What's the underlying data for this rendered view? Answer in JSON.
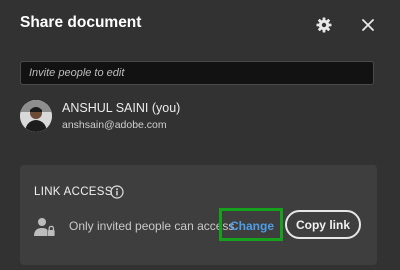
{
  "dialog": {
    "title": "Share document",
    "settings_icon": "gear-icon",
    "close_icon": "close-icon"
  },
  "invite": {
    "placeholder": "Invite people to edit",
    "value": ""
  },
  "user": {
    "name": "ANSHUL SAINI (you)",
    "email": "anshsain@adobe.com"
  },
  "link_access": {
    "heading": "LINK ACCESS",
    "info_icon": "info-icon",
    "lock_icon": "lock-person-icon",
    "status_text": "Only invited people can access.",
    "change_label": "Change",
    "copy_label": "Copy link"
  },
  "colors": {
    "background": "#323232",
    "panel": "#3e3e3e",
    "link": "#4f9de6",
    "highlight": "#16a11c"
  }
}
